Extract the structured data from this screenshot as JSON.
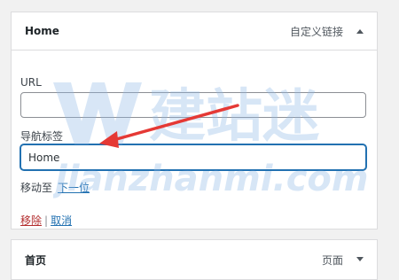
{
  "menu_item": {
    "title": "Home",
    "type_label": "自定义链接",
    "url_label": "URL",
    "url_value": "",
    "nav_label_label": "导航标签",
    "nav_label_value": "Home",
    "move_label": "移动至",
    "move_down_link": "下一位",
    "remove_link": "移除",
    "separator": "|",
    "cancel_link": "取消"
  },
  "second_item": {
    "title": "首页",
    "type_label": "页面"
  },
  "watermark": {
    "brand": "建站迷",
    "url": "jianzhanmi.com"
  },
  "colors": {
    "accent": "#2271b1",
    "remove": "#b32d2e",
    "annotation_arrow": "#e53935",
    "watermark": "#c7dcf3"
  }
}
